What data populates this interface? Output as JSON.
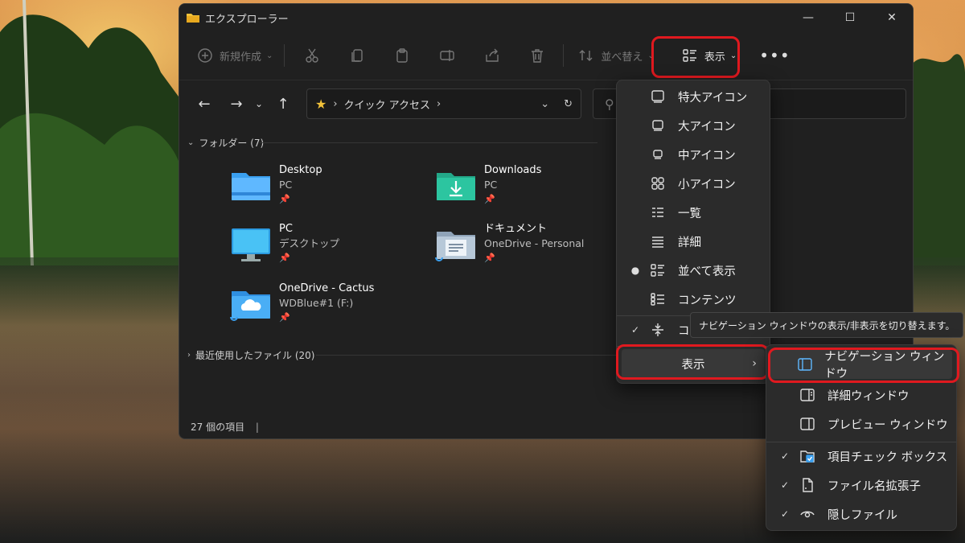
{
  "window": {
    "title": "エクスプローラー",
    "controls": [
      "—",
      "☐",
      "✕"
    ]
  },
  "toolbar": {
    "new_label": "新規作成",
    "sort_label": "並べ替え",
    "view_label": "表示",
    "more_label": "•••"
  },
  "address": {
    "path_label": "クイック アクセス"
  },
  "sections": {
    "folders_label": "フォルダー (7)",
    "recent_label": "最近使用したファイル (20)"
  },
  "folders": [
    {
      "name": "Desktop",
      "location": "PC"
    },
    {
      "name": "Downloads",
      "location": "PC"
    },
    {
      "name": "PC",
      "location": "デスクトップ"
    },
    {
      "name": "ドキュメント",
      "location": "OneDrive - Personal"
    },
    {
      "name": "OneDrive - Cactus",
      "location": "WDBlue#1 (F:)"
    }
  ],
  "status": {
    "item_count": "27 個の項目"
  },
  "view_menu": {
    "items": [
      {
        "label": "特大アイコン",
        "icon": "extra-large-icons-icon"
      },
      {
        "label": "大アイコン",
        "icon": "large-icons-icon"
      },
      {
        "label": "中アイコン",
        "icon": "medium-icons-icon"
      },
      {
        "label": "小アイコン",
        "icon": "small-icons-icon"
      },
      {
        "label": "一覧",
        "icon": "list-icon"
      },
      {
        "label": "詳細",
        "icon": "details-icon"
      },
      {
        "label": "並べて表示",
        "icon": "tiles-icon",
        "selected": true
      },
      {
        "label": "コンテンツ",
        "icon": "content-icon"
      },
      {
        "label": "コ",
        "icon": "compact-view-icon",
        "checked": true
      }
    ],
    "submenu_label": "表示"
  },
  "tooltip": "ナビゲーション ウィンドウの表示/非表示を切り替えます。",
  "show_submenu": {
    "items": [
      {
        "label": "ナビゲーション ウィンドウ",
        "icon": "navigation-pane-icon"
      },
      {
        "label": "詳細ウィンドウ",
        "icon": "details-pane-icon"
      },
      {
        "label": "プレビュー ウィンドウ",
        "icon": "preview-pane-icon"
      },
      {
        "label": "項目チェック ボックス",
        "icon": "item-checkbox-icon",
        "checked": true
      },
      {
        "label": "ファイル名拡張子",
        "icon": "file-extension-icon",
        "checked": true
      },
      {
        "label": "隠しファイル",
        "icon": "hidden-files-icon",
        "checked": true
      }
    ]
  },
  "colors": {
    "highlight": "#e0191f",
    "accent_blue": "#3aa0f0",
    "star": "#f2c23a"
  }
}
